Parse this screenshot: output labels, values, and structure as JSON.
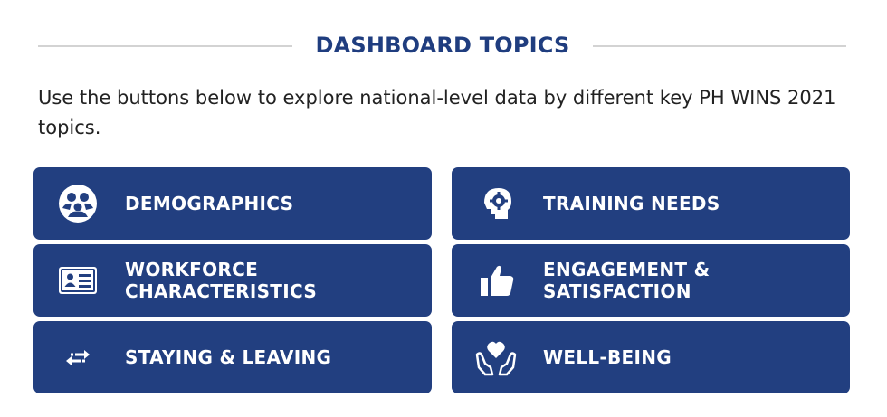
{
  "header": {
    "title": "DASHBOARD TOPICS"
  },
  "intro": {
    "text": "Use the buttons below to explore national-level data by different key PH WINS 2021 topics."
  },
  "colors": {
    "tile_bg": "#223f80",
    "title": "#1f3d7f",
    "rule": "#d3d3d3"
  },
  "topics": [
    {
      "label": "DEMOGRAPHICS",
      "icon": "people-group-icon"
    },
    {
      "label": "TRAINING NEEDS",
      "icon": "head-gear-icon"
    },
    {
      "label": "WORKFORCE CHARACTERISTICS",
      "icon": "id-card-icon"
    },
    {
      "label": "ENGAGEMENT & SATISFACTION",
      "icon": "thumbs-up-icon"
    },
    {
      "label": "STAYING & LEAVING",
      "icon": "arrows-exchange-icon"
    },
    {
      "label": "WELL-BEING",
      "icon": "hands-heart-icon"
    }
  ]
}
